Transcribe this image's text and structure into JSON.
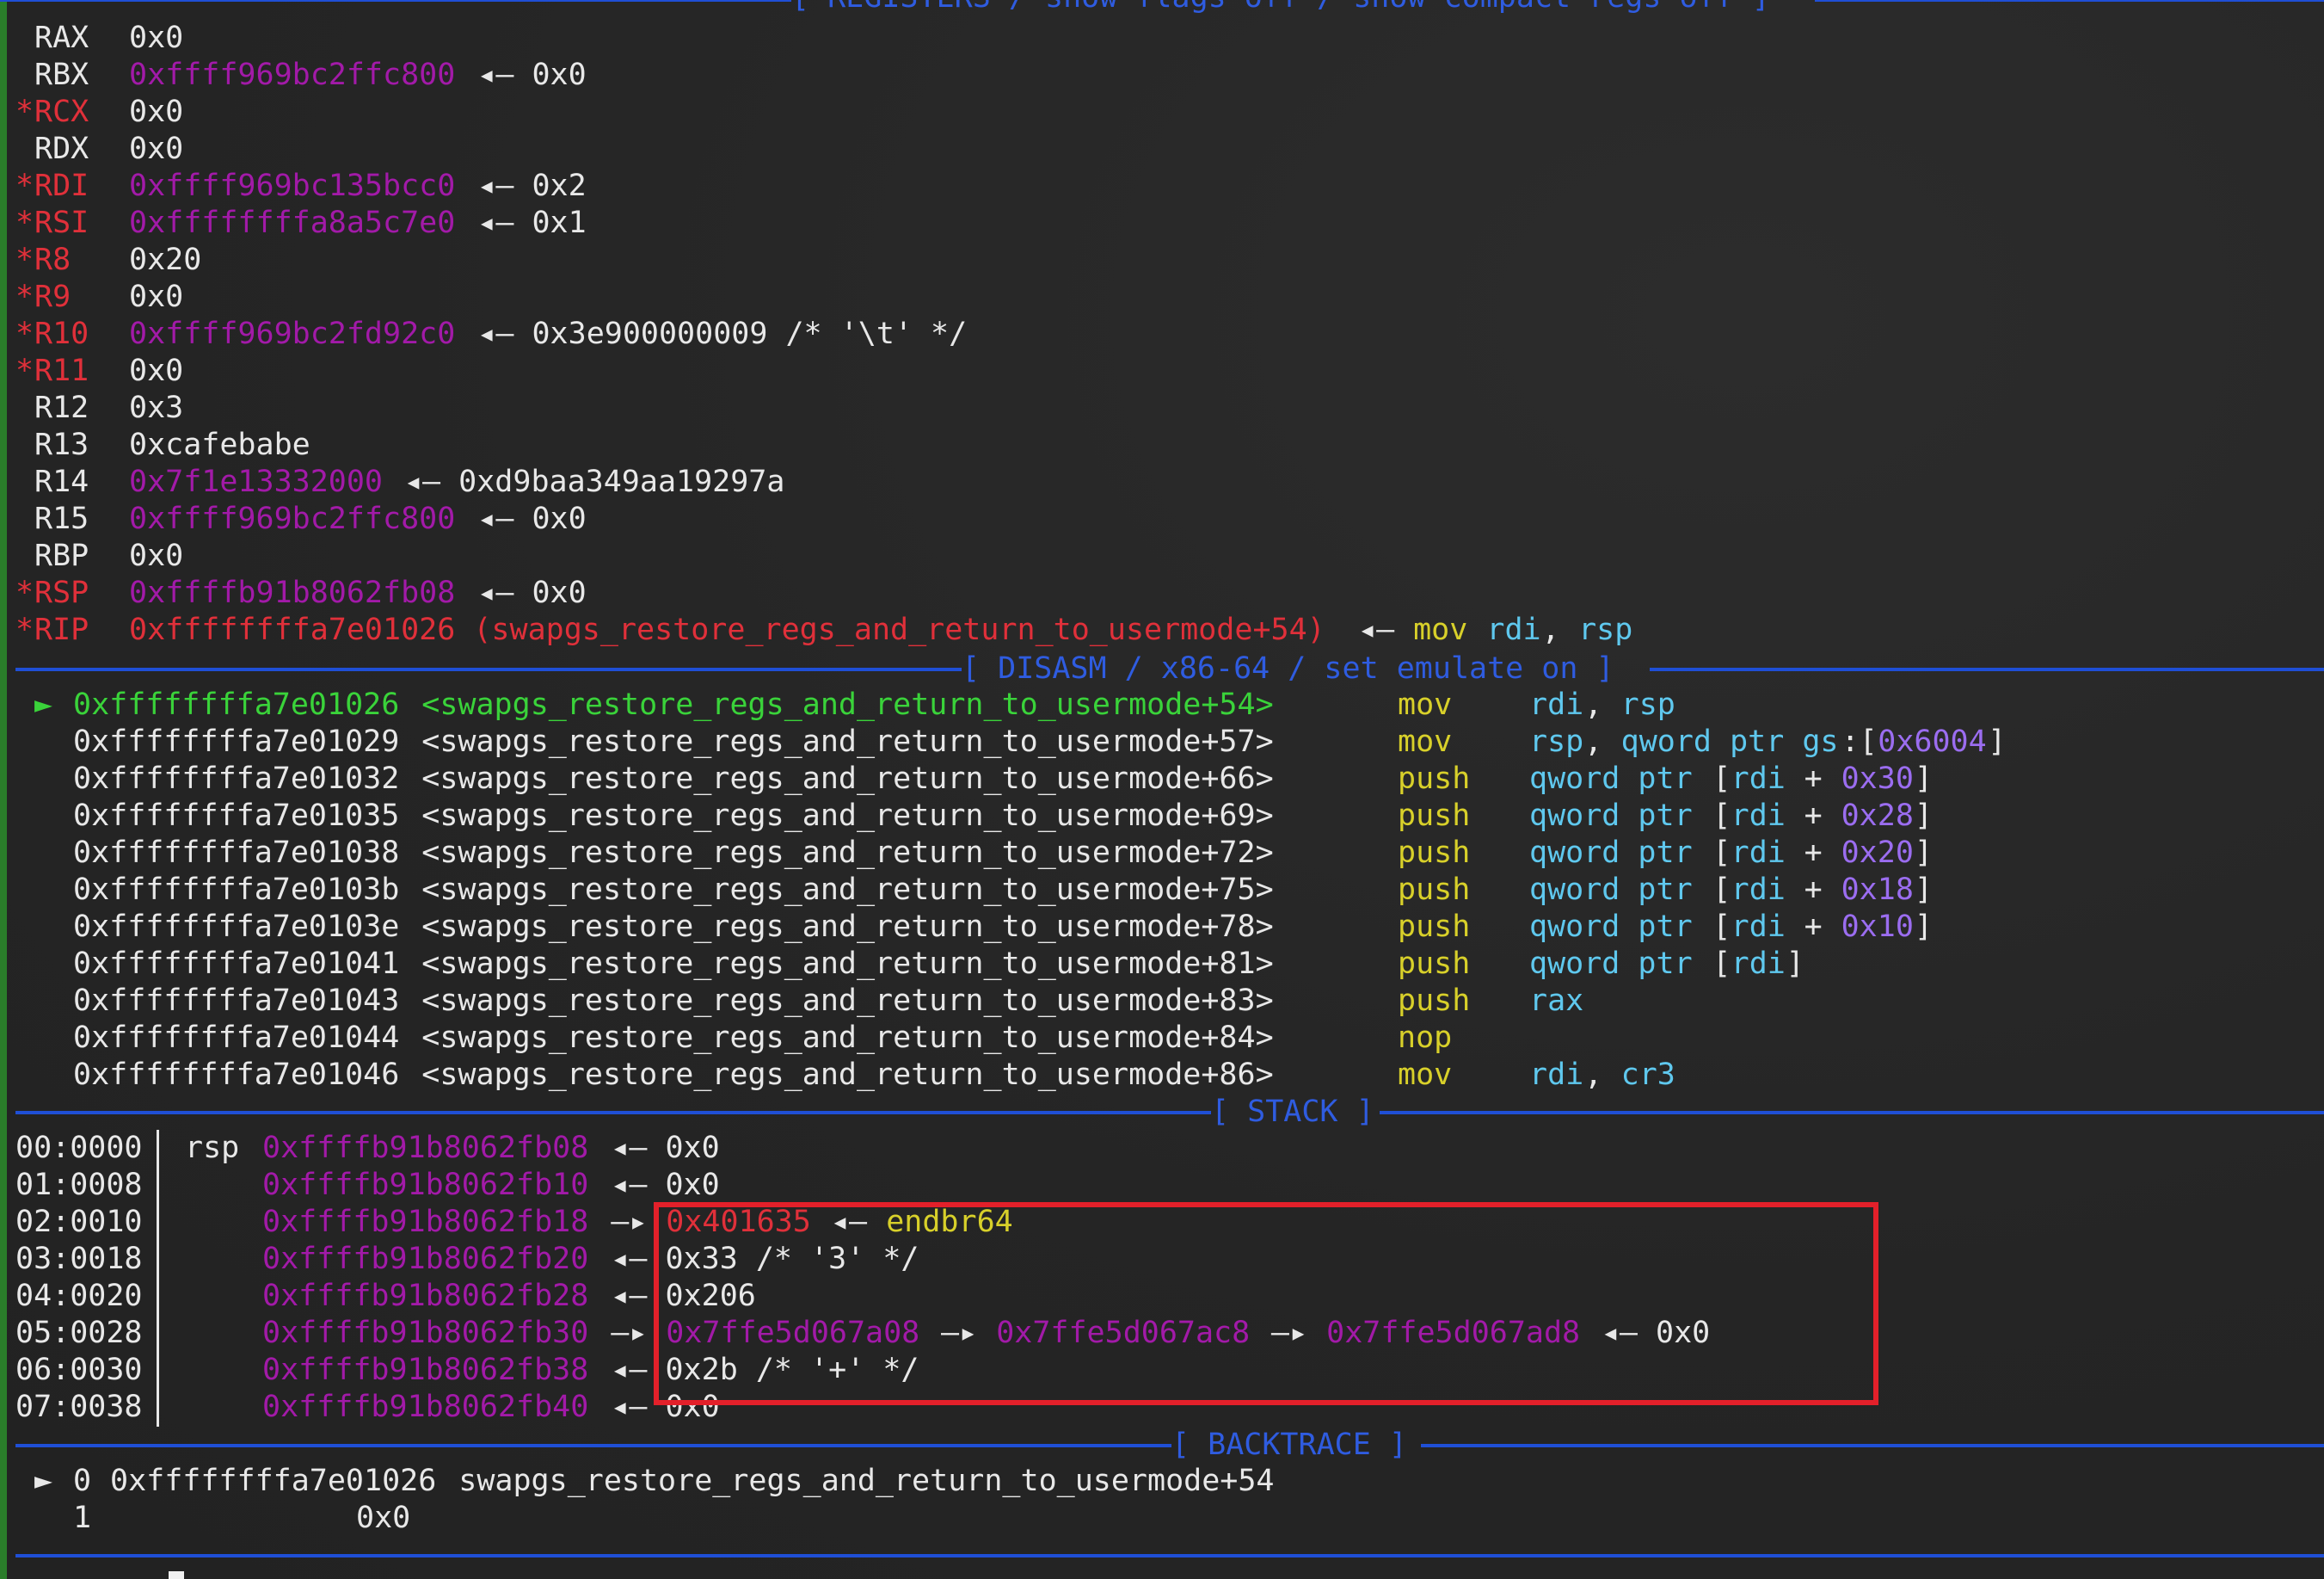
{
  "headers": {
    "registers": "[ REGISTERS / show-flags off / show-compact-regs off ]",
    "disasm": "[ DISASM / x86-64 / set emulate on ]",
    "stack": "[ STACK ]",
    "backtrace": "[ BACKTRACE ]"
  },
  "colors": {
    "register_changed": "#e0303a",
    "pointer": "#a21aa8",
    "current_instruction": "#3ad33a",
    "mnemonic": "#d8d02a",
    "operand_register": "#5fc8ee",
    "immediate": "#9b6df0",
    "header": "#2f5ce0",
    "highlight_box": "#e3202a"
  },
  "registers": [
    {
      "marker": " ",
      "name": "RAX",
      "value": "0x0",
      "value_color": "w",
      "deref": "",
      "comment": ""
    },
    {
      "marker": " ",
      "name": "RBX",
      "value": "0xffff969bc2ffc800",
      "value_color": "p",
      "deref": "◂— 0x0",
      "comment": ""
    },
    {
      "marker": "*",
      "name": "RCX",
      "value": "0x0",
      "value_color": "w",
      "deref": "",
      "comment": ""
    },
    {
      "marker": " ",
      "name": "RDX",
      "value": "0x0",
      "value_color": "w",
      "deref": "",
      "comment": ""
    },
    {
      "marker": "*",
      "name": "RDI",
      "value": "0xffff969bc135bcc0",
      "value_color": "p",
      "deref": "◂— 0x2",
      "comment": ""
    },
    {
      "marker": "*",
      "name": "RSI",
      "value": "0xffffffffa8a5c7e0",
      "value_color": "p",
      "deref": "◂— 0x1",
      "comment": ""
    },
    {
      "marker": "*",
      "name": "R8",
      "value": "0x20",
      "value_color": "w",
      "deref": "",
      "comment": ""
    },
    {
      "marker": "*",
      "name": "R9",
      "value": "0x0",
      "value_color": "w",
      "deref": "",
      "comment": ""
    },
    {
      "marker": "*",
      "name": "R10",
      "value": "0xffff969bc2fd92c0",
      "value_color": "p",
      "deref": "◂— 0x3e900000009 /* '\\t' */",
      "comment": ""
    },
    {
      "marker": "*",
      "name": "R11",
      "value": "0x0",
      "value_color": "w",
      "deref": "",
      "comment": ""
    },
    {
      "marker": " ",
      "name": "R12",
      "value": "0x3",
      "value_color": "w",
      "deref": "",
      "comment": ""
    },
    {
      "marker": " ",
      "name": "R13",
      "value": "0xcafebabe",
      "value_color": "w",
      "deref": "",
      "comment": ""
    },
    {
      "marker": " ",
      "name": "R14",
      "value": "0x7f1e13332000",
      "value_color": "p",
      "deref": "◂— 0xd9baa349aa19297a",
      "comment": ""
    },
    {
      "marker": " ",
      "name": "R15",
      "value": "0xffff969bc2ffc800",
      "value_color": "p",
      "deref": "◂— 0x0",
      "comment": ""
    },
    {
      "marker": " ",
      "name": "RBP",
      "value": "0x0",
      "value_color": "w",
      "deref": "",
      "comment": ""
    },
    {
      "marker": "*",
      "name": "RSP",
      "value": "0xffffb91b8062fb08",
      "value_color": "p",
      "deref": "◂— 0x0",
      "comment": ""
    },
    {
      "marker": "*",
      "name": "RIP",
      "value": "0xffffffffa7e01026 (swapgs_restore_regs_and_return_to_usermode+54)",
      "value_color": "r",
      "deref": "◂—",
      "comment": "mov rdi, rsp"
    }
  ],
  "rip_instr": {
    "arrow": "◂—",
    "mnemonic": "mov",
    "op1": "rdi",
    "sep": ", ",
    "op2": "rsp"
  },
  "disasm": [
    {
      "current": true,
      "addr": "0xffffffffa7e01026",
      "sym": "<swapgs_restore_regs_and_return_to_usermode+54>",
      "mnemonic": "mov",
      "ops": [
        [
          "c",
          "rdi"
        ],
        [
          "w",
          ", "
        ],
        [
          "c",
          "rsp"
        ]
      ]
    },
    {
      "current": false,
      "addr": "0xffffffffa7e01029",
      "sym": "<swapgs_restore_regs_and_return_to_usermode+57>",
      "mnemonic": "mov",
      "ops": [
        [
          "c",
          "rsp"
        ],
        [
          "w",
          ", "
        ],
        [
          "c",
          "qword ptr gs"
        ],
        [
          "w",
          ":["
        ],
        [
          "v",
          "0x6004"
        ],
        [
          "w",
          "]"
        ]
      ]
    },
    {
      "current": false,
      "addr": "0xffffffffa7e01032",
      "sym": "<swapgs_restore_regs_and_return_to_usermode+66>",
      "mnemonic": "push",
      "ops": [
        [
          "c",
          "qword ptr "
        ],
        [
          "w",
          "["
        ],
        [
          "c",
          "rdi"
        ],
        [
          "w",
          " + "
        ],
        [
          "v",
          "0x30"
        ],
        [
          "w",
          "]"
        ]
      ]
    },
    {
      "current": false,
      "addr": "0xffffffffa7e01035",
      "sym": "<swapgs_restore_regs_and_return_to_usermode+69>",
      "mnemonic": "push",
      "ops": [
        [
          "c",
          "qword ptr "
        ],
        [
          "w",
          "["
        ],
        [
          "c",
          "rdi"
        ],
        [
          "w",
          " + "
        ],
        [
          "v",
          "0x28"
        ],
        [
          "w",
          "]"
        ]
      ]
    },
    {
      "current": false,
      "addr": "0xffffffffa7e01038",
      "sym": "<swapgs_restore_regs_and_return_to_usermode+72>",
      "mnemonic": "push",
      "ops": [
        [
          "c",
          "qword ptr "
        ],
        [
          "w",
          "["
        ],
        [
          "c",
          "rdi"
        ],
        [
          "w",
          " + "
        ],
        [
          "v",
          "0x20"
        ],
        [
          "w",
          "]"
        ]
      ]
    },
    {
      "current": false,
      "addr": "0xffffffffa7e0103b",
      "sym": "<swapgs_restore_regs_and_return_to_usermode+75>",
      "mnemonic": "push",
      "ops": [
        [
          "c",
          "qword ptr "
        ],
        [
          "w",
          "["
        ],
        [
          "c",
          "rdi"
        ],
        [
          "w",
          " + "
        ],
        [
          "v",
          "0x18"
        ],
        [
          "w",
          "]"
        ]
      ]
    },
    {
      "current": false,
      "addr": "0xffffffffa7e0103e",
      "sym": "<swapgs_restore_regs_and_return_to_usermode+78>",
      "mnemonic": "push",
      "ops": [
        [
          "c",
          "qword ptr "
        ],
        [
          "w",
          "["
        ],
        [
          "c",
          "rdi"
        ],
        [
          "w",
          " + "
        ],
        [
          "v",
          "0x10"
        ],
        [
          "w",
          "]"
        ]
      ]
    },
    {
      "current": false,
      "addr": "0xffffffffa7e01041",
      "sym": "<swapgs_restore_regs_and_return_to_usermode+81>",
      "mnemonic": "push",
      "ops": [
        [
          "c",
          "qword ptr "
        ],
        [
          "w",
          "["
        ],
        [
          "c",
          "rdi"
        ],
        [
          "w",
          "]"
        ]
      ]
    },
    {
      "current": false,
      "addr": "0xffffffffa7e01043",
      "sym": "<swapgs_restore_regs_and_return_to_usermode+83>",
      "mnemonic": "push",
      "ops": [
        [
          "c",
          "rax"
        ]
      ]
    },
    {
      "current": false,
      "addr": "0xffffffffa7e01044",
      "sym": "<swapgs_restore_regs_and_return_to_usermode+84>",
      "mnemonic": "nop",
      "ops": []
    },
    {
      "current": false,
      "addr": "0xffffffffa7e01046",
      "sym": "<swapgs_restore_regs_and_return_to_usermode+86>",
      "mnemonic": "mov",
      "ops": [
        [
          "c",
          "rdi"
        ],
        [
          "w",
          ", "
        ],
        [
          "c",
          "cr3"
        ]
      ]
    }
  ],
  "disasm_arrow": "►",
  "stack": [
    {
      "idx": "00:0000",
      "reg": "rsp",
      "addr": "0xffffb91b8062fb08",
      "chain": [
        [
          "w",
          "◂— 0x0"
        ]
      ]
    },
    {
      "idx": "01:0008",
      "reg": "",
      "addr": "0xffffb91b8062fb10",
      "chain": [
        [
          "w",
          "◂— 0x0"
        ]
      ]
    },
    {
      "idx": "02:0010",
      "reg": "",
      "addr": "0xffffb91b8062fb18",
      "chain": [
        [
          "w",
          "—▸ "
        ],
        [
          "r",
          "0x401635"
        ],
        [
          "w",
          " ◂— "
        ],
        [
          "y",
          "endbr64"
        ]
      ]
    },
    {
      "idx": "03:0018",
      "reg": "",
      "addr": "0xffffb91b8062fb20",
      "chain": [
        [
          "w",
          "◂— 0x33 /* '3' */"
        ]
      ]
    },
    {
      "idx": "04:0020",
      "reg": "",
      "addr": "0xffffb91b8062fb28",
      "chain": [
        [
          "w",
          "◂— 0x206"
        ]
      ]
    },
    {
      "idx": "05:0028",
      "reg": "",
      "addr": "0xffffb91b8062fb30",
      "chain": [
        [
          "w",
          "—▸ "
        ],
        [
          "p",
          "0x7ffe5d067a08"
        ],
        [
          "w",
          " —▸ "
        ],
        [
          "p",
          "0x7ffe5d067ac8"
        ],
        [
          "w",
          " —▸ "
        ],
        [
          "p",
          "0x7ffe5d067ad8"
        ],
        [
          "w",
          " ◂— 0x0"
        ]
      ]
    },
    {
      "idx": "06:0030",
      "reg": "",
      "addr": "0xffffb91b8062fb38",
      "chain": [
        [
          "w",
          "◂— 0x2b /* '+' */"
        ]
      ]
    },
    {
      "idx": "07:0038",
      "reg": "",
      "addr": "0xffffb91b8062fb40",
      "chain": [
        [
          "w",
          "◂— 0x0"
        ]
      ]
    }
  ],
  "backtrace": [
    {
      "arrow": "►",
      "num": "0",
      "addr": "0xffffffffa7e01026",
      "sym": "swapgs_restore_regs_and_return_to_usermode+54"
    },
    {
      "arrow": " ",
      "num": "1",
      "addr": "0x0",
      "sym": ""
    }
  ]
}
